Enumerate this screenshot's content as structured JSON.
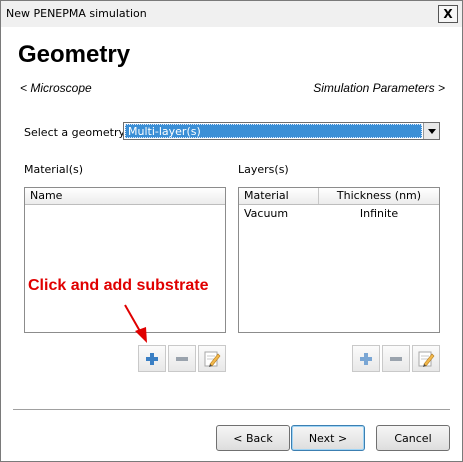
{
  "window": {
    "title": "New PENEPMA simulation",
    "close_label": "X"
  },
  "page": {
    "title": "Geometry",
    "back_link": "< Microscope",
    "next_link": "Simulation Parameters >"
  },
  "geometry": {
    "label": "Select a geometry",
    "selected": "Multi-layer(s)"
  },
  "materials": {
    "label": "Material(s)",
    "columns": [
      "Name"
    ],
    "rows": []
  },
  "layers": {
    "label": "Layers(s)",
    "columns": [
      "Material",
      "Thickness (nm)"
    ],
    "rows": [
      {
        "material": "Vacuum",
        "thickness": "Infinite"
      }
    ]
  },
  "annotation": {
    "text": "Click and add substrate",
    "color": "#e00000"
  },
  "buttons": {
    "back": "< Back",
    "next": "Next >",
    "cancel": "Cancel"
  },
  "icons": {
    "add": "plus-icon",
    "remove": "minus-icon",
    "edit": "edit-icon"
  },
  "colors": {
    "selection": "#3b8fd6",
    "add_icon": "#3a7fc4"
  }
}
